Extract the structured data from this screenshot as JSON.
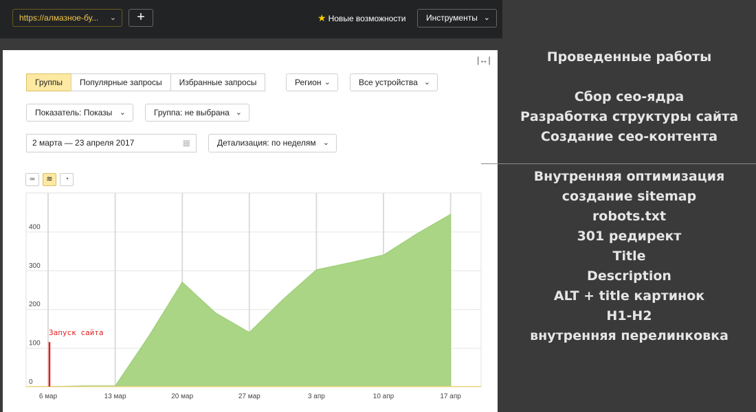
{
  "topbar": {
    "url": "https://алмазное-бу...",
    "plus": "+",
    "whats_new": "Новые возможности",
    "tools": "Инструменты"
  },
  "filters": {
    "tabs": [
      {
        "label": "Группы",
        "active": true
      },
      {
        "label": "Популярные запросы",
        "active": false
      },
      {
        "label": "Избранные запросы",
        "active": false
      }
    ],
    "region": "Регион",
    "devices": "Все устройства",
    "indicator": "Показатель: Показы",
    "group": "Группа: не выбрана",
    "date_range": "2 марта — 23 апреля 2017",
    "detail": "Детализация: по неделям"
  },
  "chart_data": {
    "type": "area",
    "x": [
      "6 мар",
      "",
      "13 мар",
      "",
      "20 мар",
      "",
      "27 мар",
      "",
      "3 апр",
      "",
      "10 апр",
      "",
      "17 апр",
      ""
    ],
    "x_ticks": [
      "6 мар",
      "13 мар",
      "20 мар",
      "27 мар",
      "3 апр",
      "10 апр",
      "17 апр"
    ],
    "values": [
      0,
      2,
      2,
      130,
      270,
      190,
      140,
      225,
      302,
      320,
      340,
      395,
      445
    ],
    "yticks": [
      0,
      100,
      200,
      300,
      400
    ],
    "ylim": [
      0,
      500
    ],
    "series_color": "#a9d585",
    "annotation": {
      "label": "Запуск сайта",
      "x": "6 мар",
      "value": 115,
      "color": "#e02020"
    },
    "grid": true
  },
  "right_panel": {
    "title": "Проведенные работы",
    "works": [
      "Сбор сео-ядра",
      "Разработка структуры сайта",
      "Создание сео-контента"
    ],
    "optimization": [
      "Внутренняя оптимизация",
      "создание sitemap",
      "robots.txt",
      "301 редирект",
      "Title",
      "Description",
      "ALT + title картинок",
      "H1-H2",
      "внутренняя перелинковка"
    ]
  }
}
